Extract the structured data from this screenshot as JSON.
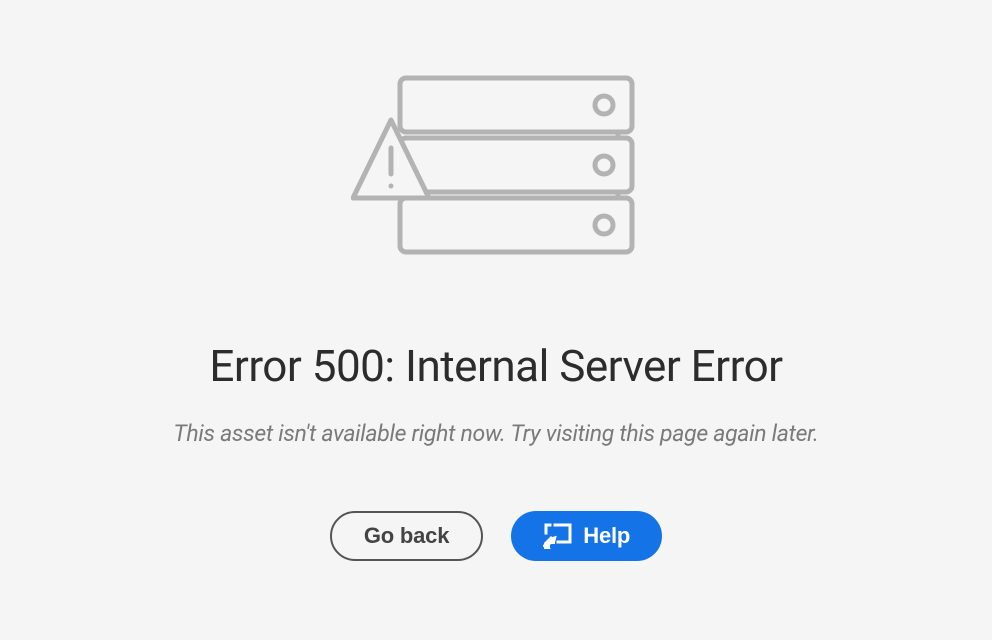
{
  "error": {
    "title": "Error 500: Internal Server Error",
    "message": "This asset isn't available right now. Try visiting this page again later."
  },
  "actions": {
    "go_back_label": "Go back",
    "help_label": "Help"
  }
}
